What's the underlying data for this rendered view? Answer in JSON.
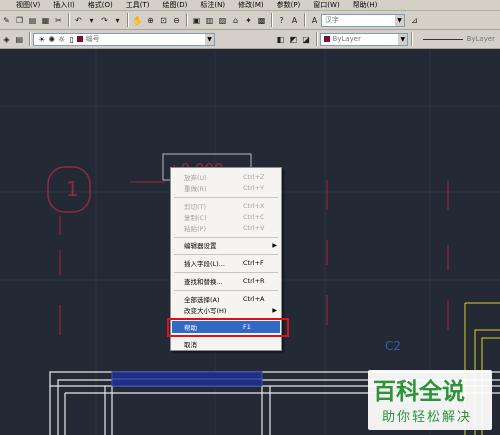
{
  "menubar": {
    "items": [
      "视图(V)",
      "插入(I)",
      "格式(O)",
      "工具(T)",
      "绘图(D)",
      "标注(N)",
      "修改(M)",
      "参数(P)",
      "窗口(W)",
      "帮助(H)"
    ]
  },
  "toolbar": {
    "text_style_value": "汉字",
    "layer_value": "编号",
    "color_value": "ByLayer",
    "linetype_value": "ByLayer",
    "layer_color": "#7d1027"
  },
  "canvas": {
    "label_c2": "C2",
    "text_box_label": "+0.000"
  },
  "context_menu": {
    "items": [
      {
        "label": "放弃(U)",
        "shortcut": "Ctrl+Z",
        "disabled": true
      },
      {
        "label": "重做(R)",
        "shortcut": "Ctrl+Y",
        "disabled": true
      },
      {
        "label": "剪切(T)",
        "shortcut": "Ctrl+X",
        "disabled": true
      },
      {
        "label": "复制(C)",
        "shortcut": "Ctrl+C",
        "disabled": true
      },
      {
        "label": "粘贴(P)",
        "shortcut": "Ctrl+V",
        "disabled": true
      },
      {
        "label": "编辑器设置",
        "submenu": true
      },
      {
        "label": "插入字段(L)...",
        "shortcut": "Ctrl+F"
      },
      {
        "label": "查找和替换...",
        "shortcut": "Ctrl+R"
      },
      {
        "label": "全部选择(A)",
        "shortcut": "Ctrl+A"
      },
      {
        "label": "改变大小写(H)",
        "submenu": true
      },
      {
        "label": "帮助",
        "shortcut": "F1",
        "highlighted": true
      },
      {
        "label": "取消"
      }
    ],
    "highlight_color": "#316ac5",
    "annotation_color": "#e0101a"
  },
  "watermark": {
    "title": "百科全说",
    "subtitle": "助你轻松解决",
    "color": "#2e9438"
  }
}
